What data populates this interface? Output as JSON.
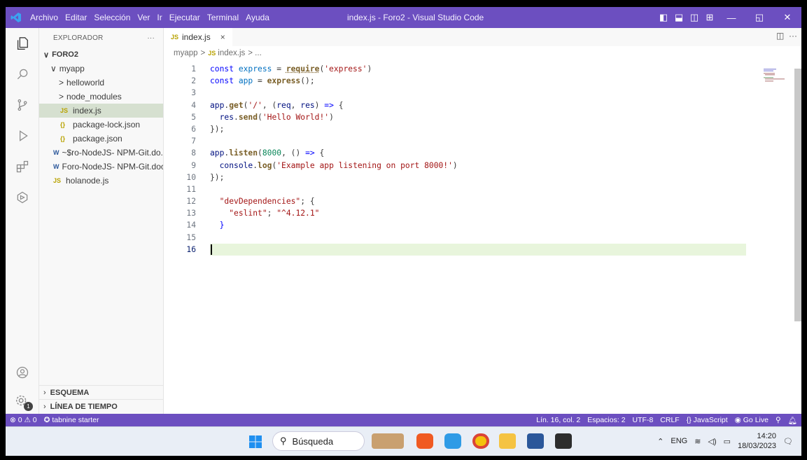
{
  "window": {
    "title": "index.js - Foro2 - Visual Studio Code",
    "menu": [
      "Archivo",
      "Editar",
      "Selección",
      "Ver",
      "Ir",
      "Ejecutar",
      "Terminal",
      "Ayuda"
    ],
    "accent": "#6c4fc0"
  },
  "activity_bar": [
    "explorer-icon",
    "search-icon",
    "source-control-icon",
    "run-debug-icon",
    "extensions-icon",
    "remote-icon"
  ],
  "sidebar": {
    "header": "EXPLORADOR",
    "header_more": "···",
    "root": "FORO2",
    "items": [
      {
        "label": "myapp",
        "prefix": "∨"
      },
      {
        "label": "helloworld",
        "prefix": ">"
      },
      {
        "label": "node_modules",
        "prefix": ">"
      },
      {
        "label": "index.js",
        "icon": "JS"
      },
      {
        "label": "package-lock.json",
        "icon": "{}"
      },
      {
        "label": "package.json",
        "icon": "{}"
      },
      {
        "label": "~$ro-NodeJS- NPM-Git.do...",
        "icon": "W"
      },
      {
        "label": "Foro-NodeJS- NPM-Git.docx",
        "icon": "W"
      },
      {
        "label": "holanode.js",
        "icon": "JS"
      }
    ],
    "outline": "ESQUEMA",
    "timeline": "LÍNEA DE TIEMPO",
    "badge": "1"
  },
  "editor": {
    "tab": "index.js",
    "tab_icon": "JS",
    "tab_close": "×",
    "breadcrumb": {
      "folder": "myapp",
      "sep": ">",
      "file": "index.js",
      "tail": "> ..."
    },
    "line_numbers": [
      "1",
      "2",
      "3",
      "4",
      "5",
      "6",
      "7",
      "8",
      "9",
      "10",
      "11",
      "12",
      "13",
      "14",
      "15",
      "16"
    ],
    "lines": [
      "const express = require('express')",
      "const app = express();",
      "",
      "app.get('/', (req, res) => {",
      "  res.send('Hello World!')",
      "});",
      "",
      "app.listen(8000, () => {",
      "  console.log('Example app listening on port 8000!')",
      "});",
      "",
      "  \"devDependencies\"; {",
      "    \"eslint\"; \"^4.12.1\"",
      "  }",
      "",
      ""
    ],
    "active_line": 16
  },
  "statusbar": {
    "problems": "⊗ 0 ⚠ 0",
    "tabnine": "tabnine starter",
    "position": "Lín. 16, col. 2",
    "spaces": "Espacios: 2",
    "encoding": "UTF-8",
    "eol": "CRLF",
    "language": "JavaScript",
    "golive": "Go Live"
  },
  "taskbar": {
    "search_placeholder": "Búsqueda",
    "lang": "ENG",
    "time": "14:20",
    "date": "18/03/2023"
  }
}
